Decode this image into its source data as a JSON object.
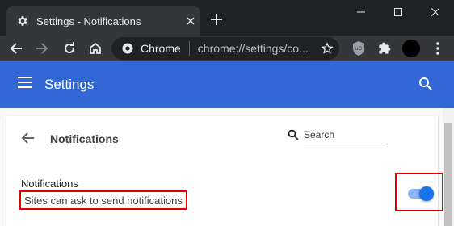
{
  "tab": {
    "title": "Settings - Notifications"
  },
  "omnibox": {
    "chip_label": "Chrome",
    "url": "chrome://settings/co..."
  },
  "settings_header": {
    "title": "Settings"
  },
  "page": {
    "title": "Notifications",
    "search_placeholder": "Search",
    "row_label": "Notifications",
    "row_sublabel": "Sites can ask to send notifications",
    "toggle_on": true
  },
  "colors": {
    "header_blue": "#3367d6",
    "toggle_accent": "#1a73e8",
    "highlight_red": "#e00000"
  },
  "icons": [
    "gear-icon",
    "close-icon",
    "plus-icon",
    "minimize-icon",
    "maximize-icon",
    "window-close-icon",
    "back-arrow-icon",
    "forward-arrow-icon",
    "reload-icon",
    "home-icon",
    "chrome-logo-icon",
    "star-icon",
    "ublock-icon",
    "extensions-puzzle-icon",
    "menu-dots-icon",
    "hamburger-menu-icon",
    "search-icon"
  ]
}
